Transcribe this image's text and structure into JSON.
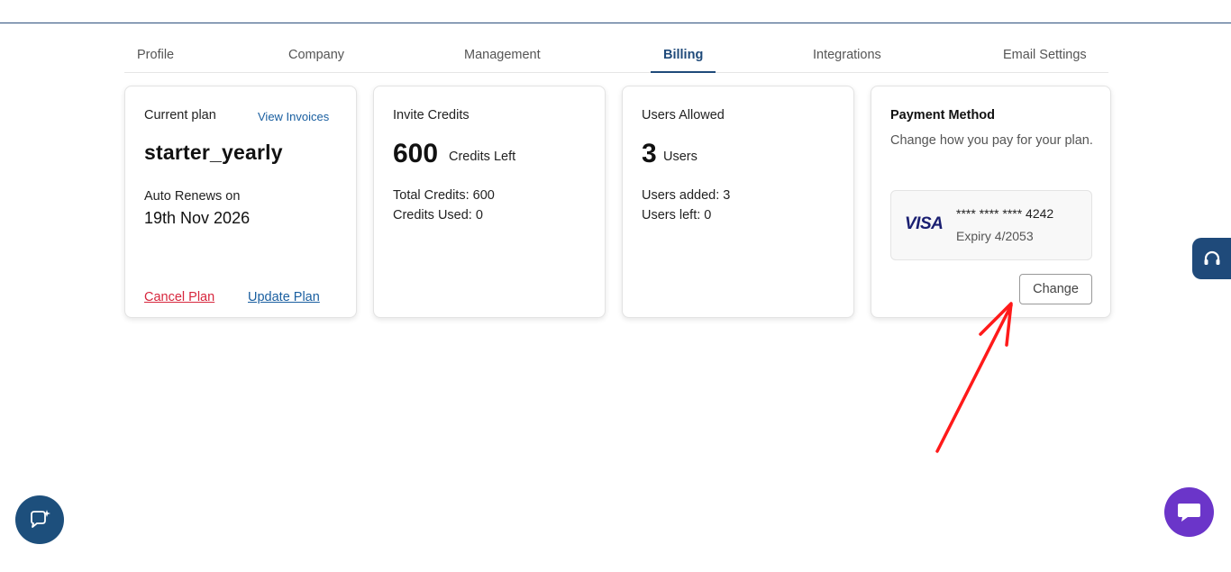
{
  "tabs": [
    {
      "label": "Profile"
    },
    {
      "label": "Company"
    },
    {
      "label": "Management"
    },
    {
      "label": "Billing",
      "active": true
    },
    {
      "label": "Integrations"
    },
    {
      "label": "Email Settings"
    }
  ],
  "plan_card": {
    "title": "Current plan",
    "view_invoices": "View Invoices",
    "plan_name": "starter_yearly",
    "renew_label": "Auto Renews on",
    "renew_date": "19th Nov 2026",
    "cancel_label": "Cancel Plan",
    "update_label": "Update Plan"
  },
  "credits_card": {
    "title": "Invite Credits",
    "value": "600",
    "unit": "Credits Left",
    "total": "Total Credits: 600",
    "used": "Credits Used: 0"
  },
  "users_card": {
    "title": "Users Allowed",
    "value": "3",
    "unit": "Users",
    "added": "Users added: 3",
    "left": "Users left: 0"
  },
  "payment_card": {
    "title": "Payment Method",
    "description": "Change how you pay for your plan.",
    "brand": "VISA",
    "card_number": "**** **** **** 4242",
    "expiry": "Expiry 4/2053",
    "change_label": "Change"
  },
  "icons": {
    "support": "headset-icon",
    "chat_left": "chat-sparkle-icon",
    "chat_right": "chat-bubble-icon",
    "annotation": "red-arrow"
  },
  "colors": {
    "primary": "#1f4a7a",
    "link": "#1a5fa0",
    "danger": "#d7263d",
    "visa": "#1a1f71",
    "chat_purple": "#6b35c9",
    "annotation_red": "#ff1a1a"
  }
}
